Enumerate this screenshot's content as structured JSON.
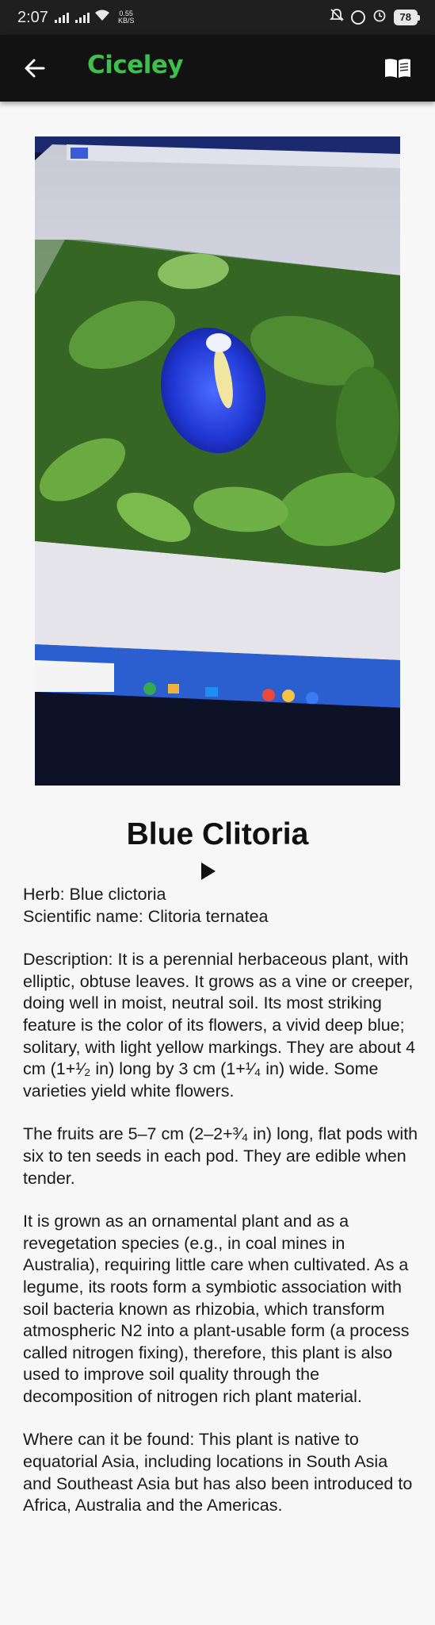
{
  "status_bar": {
    "time": "2:07",
    "net_speed_value": "0.55",
    "net_speed_unit": "KB/S",
    "battery": "78",
    "icons": [
      "signal-icon",
      "signal-icon",
      "wifi-icon",
      "mute-icon",
      "data-saver-icon",
      "alarm-icon",
      "battery-icon"
    ]
  },
  "app_bar": {
    "logo_text": "Ciceley",
    "brand_color": "#3fbf4c",
    "back_icon": "arrow-left-icon",
    "book_icon": "book-open-icon"
  },
  "plant": {
    "title": "Blue Clitoria",
    "play_icon": "play-icon",
    "herb_line": "Herb: Blue clictoria",
    "scientific_line": "Scientific name: Clitoria ternatea",
    "description": "Description: It is a perennial herbaceous plant, with elliptic, obtuse leaves. It grows as a vine or creeper, doing well in moist, neutral soil. Its most striking feature is the color of its flowers, a vivid deep blue; solitary, with light yellow markings. They are about 4 cm (1+¹⁄₂ in) long by 3 cm (1+¹⁄₄ in) wide. Some varieties yield white flowers.",
    "fruits": "The fruits are 5–7 cm (2–2+³⁄₄ in) long, flat pods with six to ten seeds in each pod. They are edible when tender.",
    "ornamental": "It is grown as an ornamental plant and as a revegetation species (e.g., in coal mines in Australia), requiring little care when cultivated. As a legume, its roots form a symbiotic association with soil bacteria known as rhizobia, which transform atmospheric N2 into a plant-usable form (a process called nitrogen fixing), therefore, this plant is also used to improve soil quality through the decomposition of nitrogen rich plant material.",
    "found": "Where can it be found: This plant is native to equatorial Asia, including locations in South Asia and Southeast Asia but has also been introduced to Africa, Australia and the Americas."
  }
}
